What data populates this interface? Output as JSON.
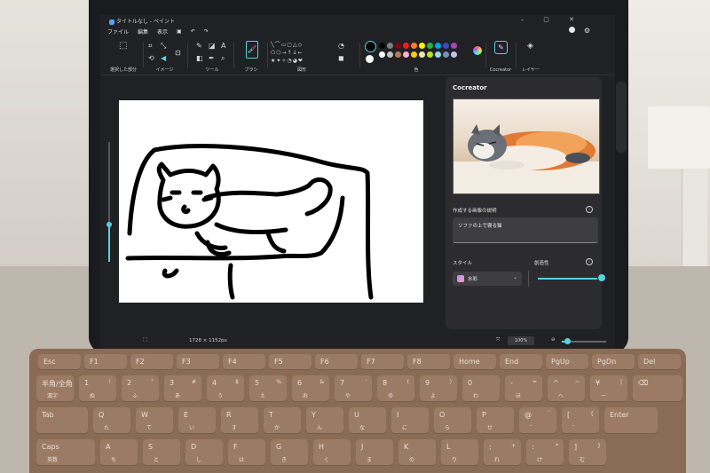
{
  "window": {
    "title": "タイトルなし - ペイント",
    "menu": [
      "ファイル",
      "編集",
      "表示"
    ]
  },
  "ribbon": {
    "groups": [
      "選択した部分",
      "イメージ",
      "ツール",
      "ブラシ",
      "図形",
      "色",
      "Cocreator",
      "レイヤー"
    ],
    "colors": [
      "#000000",
      "#7f7f7f",
      "#880015",
      "#ed1c24",
      "#ff7f27",
      "#fff200",
      "#22b14c",
      "#00a2e8",
      "#3f48cc",
      "#a349a4",
      "#ffffff",
      "#c3c3c3",
      "#b97a57",
      "#ffaec9",
      "#ffc90e",
      "#efe4b0",
      "#b5e61d",
      "#99d9ea",
      "#7092be",
      "#c8bfe7"
    ]
  },
  "cocreator": {
    "title": "Cocreator",
    "prompt_label": "作成する画像の説明",
    "prompt_value": "ソファの上で寝る猫",
    "style_label": "スタイル",
    "style_value": "水彩",
    "creativity_label": "創造性",
    "creativity_level": 0.95
  },
  "status": {
    "dimensions": "1728 × 1152px",
    "zoom": "100%"
  },
  "keyboard": {
    "row0": [
      "Esc",
      "F1",
      "F2",
      "F3",
      "F4",
      "F5",
      "F6",
      "F7",
      "F8",
      "Home",
      "End",
      "PgUp",
      "PgDn",
      "Del"
    ],
    "row1": [
      [
        "半角/全角",
        "",
        "漢字"
      ],
      [
        "1",
        "!",
        "ぬ"
      ],
      [
        "2",
        "\"",
        "ふ"
      ],
      [
        "3",
        "#",
        "あ"
      ],
      [
        "4",
        "$",
        "う"
      ],
      [
        "5",
        "%",
        "え"
      ],
      [
        "6",
        "&",
        "お"
      ],
      [
        "7",
        "'",
        "や"
      ],
      [
        "8",
        "(",
        "ゆ"
      ],
      [
        "9",
        ")",
        "よ"
      ],
      [
        "0",
        "",
        "わ"
      ],
      [
        "-",
        "=",
        "ほ"
      ],
      [
        "^",
        "~",
        "へ"
      ],
      [
        "¥",
        "|",
        "ー"
      ],
      [
        "⌫",
        "",
        ""
      ]
    ],
    "row2": [
      [
        "Tab",
        "",
        ""
      ],
      [
        "Q",
        "",
        "た"
      ],
      [
        "W",
        "",
        "て"
      ],
      [
        "E",
        "",
        "い"
      ],
      [
        "R",
        "",
        "す"
      ],
      [
        "T",
        "",
        "か"
      ],
      [
        "Y",
        "",
        "ん"
      ],
      [
        "U",
        "",
        "な"
      ],
      [
        "I",
        "",
        "に"
      ],
      [
        "O",
        "",
        "ら"
      ],
      [
        "P",
        "",
        "せ"
      ],
      [
        "@",
        "`",
        "゛"
      ],
      [
        "[",
        "{",
        "゜"
      ],
      [
        "Enter",
        "",
        ""
      ]
    ],
    "row3": [
      [
        "Caps",
        "",
        "英数"
      ],
      [
        "A",
        "",
        "ち"
      ],
      [
        "S",
        "",
        "と"
      ],
      [
        "D",
        "",
        "し"
      ],
      [
        "F",
        "",
        "は"
      ],
      [
        "G",
        "",
        "き"
      ],
      [
        "H",
        "",
        "く"
      ],
      [
        "J",
        "",
        "ま"
      ],
      [
        "K",
        "",
        "の"
      ],
      [
        "L",
        "",
        "り"
      ],
      [
        ";",
        "+",
        "れ"
      ],
      [
        ":",
        "*",
        "け"
      ],
      [
        "]",
        "}",
        "む"
      ]
    ]
  }
}
